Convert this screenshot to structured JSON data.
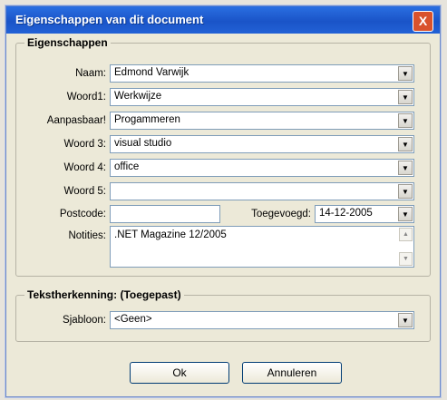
{
  "window": {
    "title": "Eigenschappen van dit document",
    "close_glyph": "X"
  },
  "properties": {
    "legend": "Eigenschappen",
    "fields": [
      {
        "label": "Naam:",
        "value": "Edmond Varwijk"
      },
      {
        "label": "Woord1:",
        "value": "Werkwijze"
      },
      {
        "label": "Aanpasbaar!",
        "value": "Progammeren"
      },
      {
        "label": "Woord 3:",
        "value": "visual studio"
      },
      {
        "label": "Woord 4:",
        "value": "office"
      },
      {
        "label": "Woord 5:",
        "value": ""
      }
    ],
    "postcode": {
      "label": "Postcode:",
      "value": ""
    },
    "added": {
      "label": "Toegevoegd:",
      "value": "14-12-2005"
    },
    "notes": {
      "label": "Notities:",
      "value": ".NET Magazine 12/2005"
    }
  },
  "recognition": {
    "legend": "Tekstherkenning: (Toegepast)",
    "template": {
      "label": "Sjabloon:",
      "value": "<Geen>"
    }
  },
  "buttons": {
    "ok": "Ok",
    "cancel": "Annuleren"
  },
  "icons": {
    "dropdown": "chevron-down-icon",
    "close": "close-icon"
  }
}
